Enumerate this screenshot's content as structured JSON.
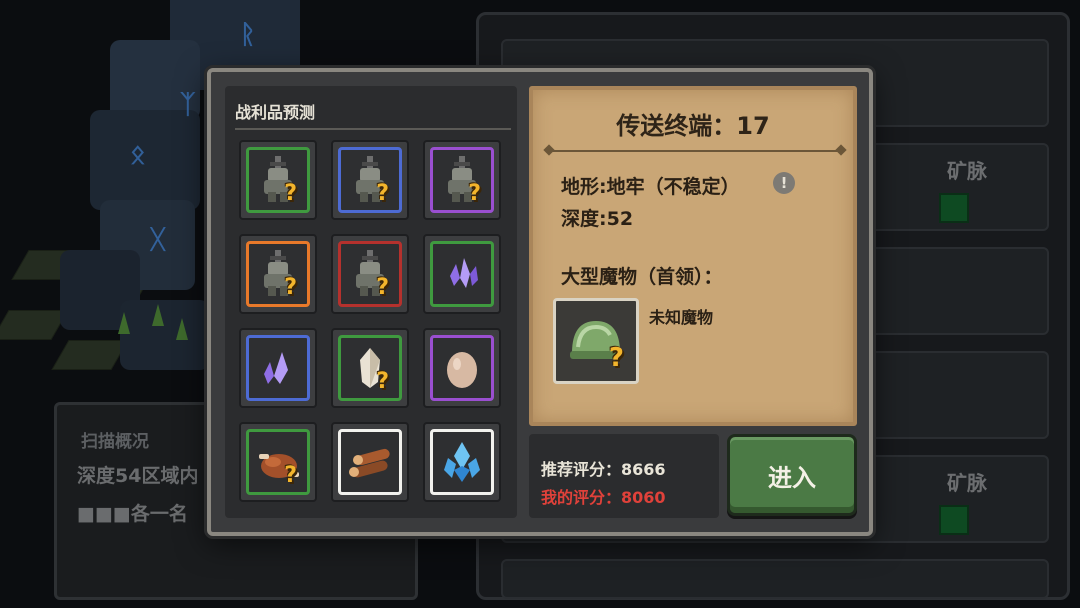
{
  "dialog": {
    "loot_title": "战利品预测",
    "loot_items": [
      {
        "icon": "armored-knight-icon",
        "rarity": "green",
        "unknown": true
      },
      {
        "icon": "armored-knight-icon",
        "rarity": "blue",
        "unknown": true
      },
      {
        "icon": "armored-knight-icon",
        "rarity": "purple",
        "unknown": true
      },
      {
        "icon": "armored-knight-icon",
        "rarity": "orange",
        "unknown": true
      },
      {
        "icon": "armored-knight-icon",
        "rarity": "red",
        "unknown": true
      },
      {
        "icon": "purple-crystal-icon",
        "rarity": "green",
        "unknown": false
      },
      {
        "icon": "purple-crystal-icon",
        "rarity": "blue",
        "unknown": false
      },
      {
        "icon": "white-crystal-icon",
        "rarity": "green",
        "unknown": true
      },
      {
        "icon": "egg-icon",
        "rarity": "purple",
        "unknown": false
      },
      {
        "icon": "roast-chicken-icon",
        "rarity": "green",
        "unknown": true
      },
      {
        "icon": "wood-logs-icon",
        "rarity": "white",
        "unknown": false
      },
      {
        "icon": "ice-crystal-icon",
        "rarity": "white",
        "unknown": false
      }
    ],
    "title": "传送终端：17",
    "terrain": "地形:地牢（不稳定）",
    "warn_icon_glyph": "!",
    "depth": "深度:52",
    "boss_heading": "大型魔物（首领）：",
    "boss_name": "未知魔物",
    "boss_icon": "slime-helmet-icon",
    "recommended_score": "推荐评分：8666",
    "my_score": "我的评分：8060",
    "enter_label": "进入"
  },
  "background": {
    "scan_title": "扫描概况",
    "scan_line1": "深度54区域内",
    "scan_line2": "■■■各一名",
    "list_row_label": "矿脉"
  },
  "colors": {
    "rarity_green": "#3f9a3f",
    "rarity_blue": "#4d6bd4",
    "rarity_purple": "#9a4fd0",
    "rarity_orange": "#e8792a",
    "rarity_red": "#b5312d",
    "rarity_white": "#f2f2ee",
    "parchment": "#c9a676",
    "enter_button": "#4b7a45",
    "my_score_red": "#e0413a"
  }
}
